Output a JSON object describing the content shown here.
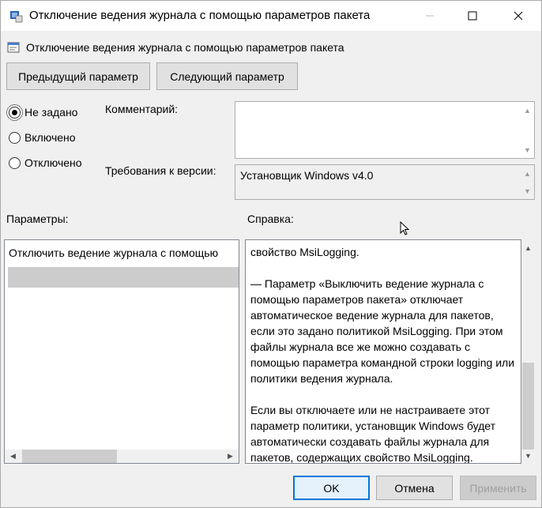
{
  "window": {
    "title": "Отключение ведения журнала с помощью параметров пакета",
    "min_label": "—",
    "max_label": "☐",
    "close_label": "✕"
  },
  "header": {
    "title": "Отключение ведения журнала с помощью параметров пакета"
  },
  "nav": {
    "prev_label": "Предыдущий параметр",
    "next_label": "Следующий параметр"
  },
  "state": {
    "options": [
      "Не задано",
      "Включено",
      "Отключено"
    ],
    "selected": "Не задано"
  },
  "comment": {
    "label": "Комментарий:",
    "value": ""
  },
  "version": {
    "label": "Требования к версии:",
    "value": "Установщик Windows v4.0"
  },
  "params": {
    "label": "Параметры:",
    "item": "Отключить ведение журнала с помощью"
  },
  "help": {
    "label": "Справка:",
    "paragraphs": [
      "свойство MsiLogging.",
      "— Параметр «Выключить ведение журнала с помощью параметров пакета» отключает автоматическое ведение журнала для пакетов, если это задано политикой MsiLogging. При этом файлы журнала все же можно создавать с помощью параметра командной строки logging или политики ведения журнала.",
      "Если вы отключаете или не настраиваете этот параметр политики, установщик Windows будет автоматически создавать файлы журнала для пакетов, содержащих свойство MsiLogging."
    ]
  },
  "footer": {
    "ok_label": "OK",
    "cancel_label": "Отмена",
    "apply_label": "Применить"
  },
  "colors": {
    "accent": "#0078d7",
    "selection": "#cccccc"
  }
}
